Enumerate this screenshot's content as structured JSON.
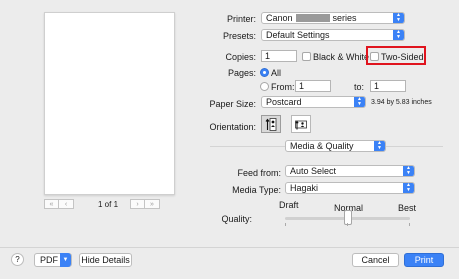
{
  "preview": {
    "page_indicator": "1 of 1",
    "first_glyph": "«",
    "prev_glyph": "‹",
    "next_glyph": "›",
    "last_glyph": "»"
  },
  "printer": {
    "label": "Printer:",
    "value_prefix": "Canon",
    "value_suffix": "series"
  },
  "presets": {
    "label": "Presets:",
    "value": "Default Settings"
  },
  "copies": {
    "label": "Copies:",
    "value": "1",
    "bw_label": "Black & White",
    "two_sided_label": "Two-Sided"
  },
  "pages": {
    "label": "Pages:",
    "all_label": "All",
    "from_label": "From:",
    "from_value": "1",
    "to_label": "to:",
    "to_value": "1"
  },
  "paper_size": {
    "label": "Paper Size:",
    "value": "Postcard",
    "dims": "3.94 by 5.83 inches"
  },
  "orientation": {
    "label": "Orientation:"
  },
  "section": {
    "value": "Media & Quality"
  },
  "feed": {
    "label": "Feed from:",
    "value": "Auto Select"
  },
  "media": {
    "label": "Media Type:",
    "value": "Hagaki"
  },
  "quality": {
    "label": "Quality:",
    "draft": "Draft",
    "normal": "Normal",
    "best": "Best",
    "level": 0.5
  },
  "footer": {
    "help": "?",
    "pdf": "PDF",
    "hide_details": "Hide Details",
    "cancel": "Cancel",
    "print": "Print"
  },
  "colors": {
    "accent": "#3b82f6",
    "highlight": "#e0141e"
  }
}
